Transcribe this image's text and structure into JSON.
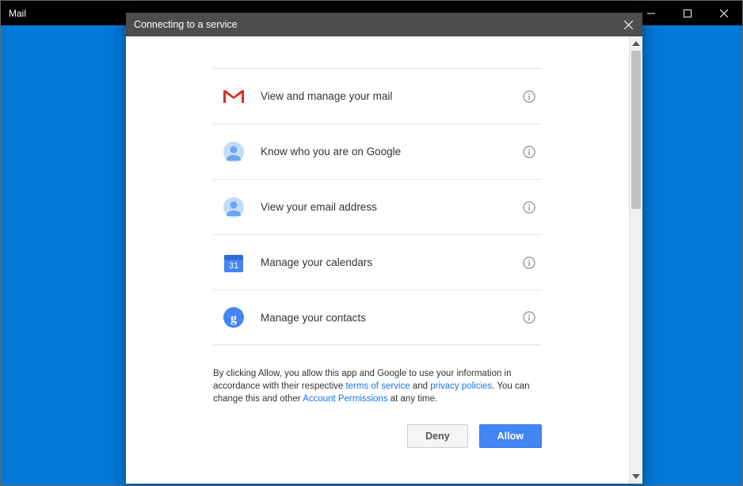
{
  "titlebar": {
    "title": "Mail"
  },
  "dialog": {
    "header": "Connecting to a service",
    "permissions": [
      {
        "label": "View and manage your mail"
      },
      {
        "label": "Know who you are on Google"
      },
      {
        "label": "View your email address"
      },
      {
        "label": "Manage your calendars"
      },
      {
        "label": "Manage your contacts"
      }
    ],
    "disclosure": {
      "prefix": "By clicking Allow, you allow this app and Google to use your information in accordance with their respective ",
      "tos": "terms of service",
      "and": " and ",
      "privacy": "privacy policies",
      "mid": ". You can change this and other ",
      "account": "Account Permissions",
      "suffix": " at any time."
    },
    "buttons": {
      "deny": "Deny",
      "allow": "Allow"
    }
  }
}
